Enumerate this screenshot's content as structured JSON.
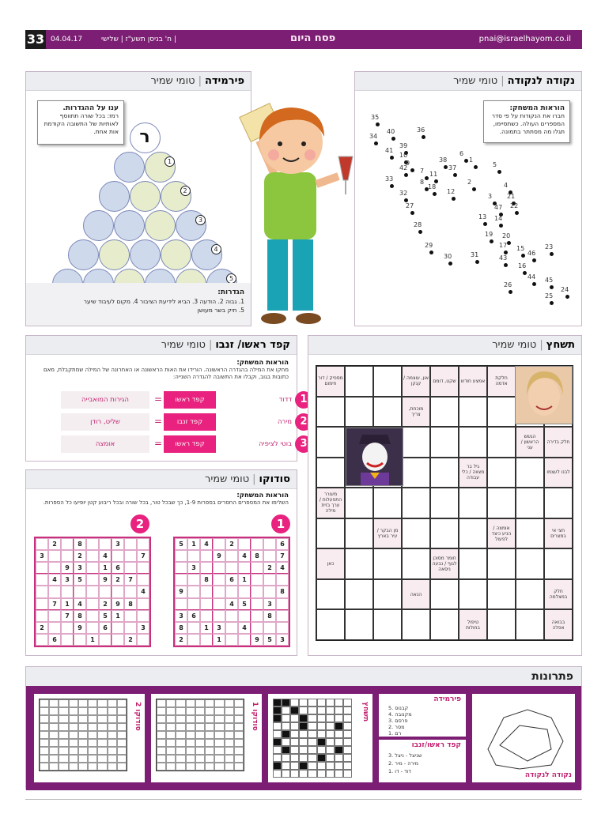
{
  "header": {
    "page_number": "33",
    "date": "04.04.17",
    "hebrew_date": "ח' בניסן תשע\"ז | שלישי |",
    "title": "פסח היום",
    "email": "pnai@israelhayom.co.il"
  },
  "pyramid": {
    "title": "פירמידה",
    "author": "טומי שמיר",
    "bubble_title": "ענו על ההגדרות.",
    "bubble_text": "רמז: בכל שורה תתווסף לאותיות של התשובה הקודמת אות אחת.",
    "top_letter": "ר",
    "row_numbers": [
      "1",
      "2",
      "3",
      "4",
      "5"
    ],
    "defs_title": "הגדרות:",
    "defs_line1": "1. גבוה 2. הודעה 3. הביא לידיעת הציבור 4. מקום לעיבוד שיער",
    "defs_line2": "5. תיק בשר מעושן"
  },
  "dots": {
    "title": "נקודה לנקודה",
    "author": "טומי שמיר",
    "bubble_title": "הוראות המשחק:",
    "bubble_text": "חברו את הנקודות על פי סדר המספרים העולה. כשתסיימו, תגלו מה מסתתר בתמונה.",
    "points": [
      {
        "n": "35"
      },
      {
        "n": "34"
      },
      {
        "n": "40"
      },
      {
        "n": "36"
      },
      {
        "n": "41"
      },
      {
        "n": "39"
      },
      {
        "n": "10"
      },
      {
        "n": "42"
      },
      {
        "n": "9"
      },
      {
        "n": "33"
      },
      {
        "n": "7"
      },
      {
        "n": "11"
      },
      {
        "n": "38"
      },
      {
        "n": "37"
      },
      {
        "n": "6"
      },
      {
        "n": "1"
      },
      {
        "n": "5"
      },
      {
        "n": "8"
      },
      {
        "n": "18"
      },
      {
        "n": "2"
      },
      {
        "n": "32"
      },
      {
        "n": "27"
      },
      {
        "n": "12"
      },
      {
        "n": "4"
      },
      {
        "n": "3"
      },
      {
        "n": "21"
      },
      {
        "n": "47"
      },
      {
        "n": "22"
      },
      {
        "n": "13"
      },
      {
        "n": "14"
      },
      {
        "n": "28"
      },
      {
        "n": "19"
      },
      {
        "n": "20"
      },
      {
        "n": "29"
      },
      {
        "n": "17"
      },
      {
        "n": "30"
      },
      {
        "n": "31"
      },
      {
        "n": "43"
      },
      {
        "n": "15"
      },
      {
        "n": "46"
      },
      {
        "n": "23"
      },
      {
        "n": "16"
      },
      {
        "n": "44"
      },
      {
        "n": "26"
      },
      {
        "n": "45"
      },
      {
        "n": "25"
      },
      {
        "n": "24"
      }
    ]
  },
  "kefod": {
    "title": "קפד ראשו/ זנבו",
    "author": "טומי שמיר",
    "instr_title": "הוראות המשחק:",
    "instr_text": "מחקו את המילה בהגדרה הראשונה. הורידו את האות הראשונה או האחרונה של המילה שמתקבלת, מאם כתובות בגוב, וקבלו את התשובה להגדרה השנייה:",
    "rows": [
      {
        "num": "1",
        "clue": "דדוד",
        "action": "קפד ראשו",
        "result": "הגירות המואבייה"
      },
      {
        "num": "2",
        "clue": "מירה",
        "action": "קפד זנבו",
        "result": "שליט, רודן"
      },
      {
        "num": "3",
        "clue": "בוטי לציפיה",
        "action": "קפד ראשו",
        "result": "אומצה"
      }
    ],
    "eq": "="
  },
  "sudoku": {
    "title": "סודוקו",
    "author": "טומי שמיר",
    "instr_title": "הוראות המשחק:",
    "instr_text": "השלימו את המספרים החסרים בספרות 1-9, כך שבכל טור, בכל שורה ובכל ריבוע קטן יופיעו כל הספרות.",
    "grid1_label": "1",
    "grid2_label": "2",
    "grid1": [
      [
        "5",
        "1",
        "4",
        "",
        "2",
        "",
        "",
        "",
        "6"
      ],
      [
        "",
        "",
        "",
        "9",
        "",
        "4",
        "8",
        "",
        "7"
      ],
      [
        "",
        "3",
        "",
        "",
        "",
        "",
        "",
        "2",
        "4"
      ],
      [
        "",
        "",
        "8",
        "",
        "6",
        "1",
        "",
        "",
        ""
      ],
      [
        "9",
        "",
        "",
        "",
        "",
        "",
        "",
        "",
        "8"
      ],
      [
        "",
        "",
        "",
        "",
        "4",
        "5",
        "",
        "3",
        ""
      ],
      [
        "3",
        "6",
        "",
        "",
        "",
        "",
        "",
        "8",
        ""
      ],
      [
        "8",
        "",
        "1",
        "3",
        "",
        "4",
        "",
        "",
        ""
      ],
      [
        "2",
        "",
        "",
        "1",
        "",
        "",
        "9",
        "5",
        "3"
      ]
    ],
    "grid2": [
      [
        "",
        "2",
        "",
        "8",
        "",
        "",
        "3",
        "",
        ""
      ],
      [
        "3",
        "",
        "",
        "2",
        "",
        "4",
        "",
        "",
        "7"
      ],
      [
        "",
        "",
        "9",
        "3",
        "",
        "1",
        "6",
        "",
        ""
      ],
      [
        "",
        "4",
        "3",
        "5",
        "",
        "9",
        "2",
        "7",
        ""
      ],
      [
        "",
        "",
        "",
        "",
        "",
        "",
        "",
        "",
        "4"
      ],
      [
        "",
        "7",
        "1",
        "4",
        "",
        "2",
        "9",
        "8",
        ""
      ],
      [
        "",
        "",
        "7",
        "8",
        "",
        "5",
        "1",
        "",
        ""
      ],
      [
        "2",
        "",
        "",
        "9",
        "",
        "6",
        "",
        "",
        "3"
      ],
      [
        "",
        "6",
        "",
        "",
        "1",
        "",
        "",
        "2",
        ""
      ]
    ]
  },
  "crossword": {
    "title": "תשחץ",
    "author": "טומי שמיר",
    "cells": [
      [
        "מספיק / דור חימום",
        "",
        "",
        "און, עוצמה / קנקן",
        "שקט, דומם",
        "אמצע חודש",
        "חלקת אדמה",
        "",
        ""
      ],
      [
        "",
        "",
        "",
        "מוכחת, צריך",
        "",
        "",
        "",
        "",
        ""
      ],
      [
        "",
        "",
        "",
        "",
        "",
        "",
        "",
        "הגשש הראשון / עני",
        "חלק בדירה"
      ],
      [
        "",
        "",
        "",
        "",
        "",
        "גיל בר מצווה / כלי עבודה",
        "",
        "",
        "לבנו לעצמו"
      ],
      [
        "מעורר התפעלות / ערך בזית מילה",
        "",
        "",
        "",
        "",
        "",
        "",
        "",
        ""
      ],
      [
        "",
        "",
        "מן הבקר / עיר בארץ",
        "",
        "",
        "",
        "אומצה / הניע כיצד לפעול",
        "",
        "חצי אי במצרים"
      ],
      [
        "כאן",
        "",
        "",
        "",
        "חומר מסוכן לגוף / נבעה ניסאה",
        "",
        "",
        "",
        ""
      ],
      [
        "",
        "",
        "",
        "הנאה",
        "",
        "",
        "",
        "",
        "חלק במצלמה"
      ],
      [
        "",
        "",
        "",
        "",
        "",
        "טיפול בחולות",
        "",
        "",
        "בבואה אפלה"
      ]
    ]
  },
  "solutions": {
    "title": "פתרונות",
    "dots_label": "נקודה לנקודה",
    "pyramid_label": "פירמידה",
    "pyramid_lines": [
      "5. קבנוס",
      "4. מקנובה",
      "3. פרסם",
      "2. מסר",
      "1. רם"
    ],
    "kefod_label": "קפד ראשו/זנבו",
    "kefod_lines": [
      "3. שניצל - ניצל",
      "2. מירה - מיר",
      "1. דוד - דו"
    ],
    "crossword_label": "תשחץ",
    "sudoku1_label": "סודוקו 1",
    "sudoku2_label": "סודוקו 2"
  }
}
